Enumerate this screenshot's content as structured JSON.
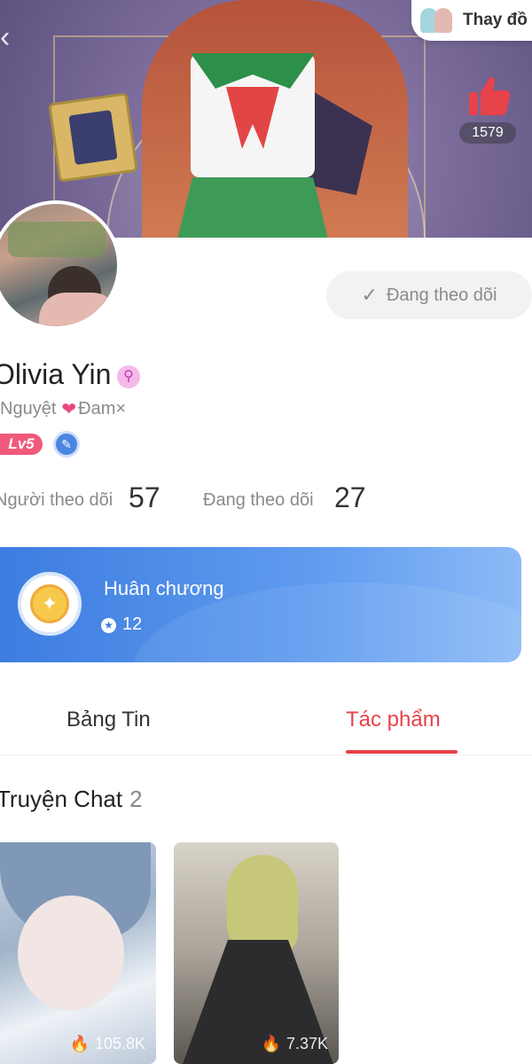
{
  "header": {
    "change_label": "Thay đồ",
    "like_count": "1579"
  },
  "profile": {
    "name": "Olivia Yin",
    "gender_symbol": "⚲",
    "tag_left": "Nguyệt",
    "tag_right": "Đam×",
    "level": "Lv5",
    "follow_button_label": "Đang theo dõi"
  },
  "stats": {
    "followers_label": "Người theo dõi",
    "followers_value": "57",
    "following_label": "Đang theo dõi",
    "following_value": "27"
  },
  "medal": {
    "title": "Huân chương",
    "count": "12"
  },
  "tabs": [
    {
      "label": "Bảng Tin",
      "active": false
    },
    {
      "label": "Tác phẩm",
      "active": true
    }
  ],
  "section": {
    "title": "Truyện Chat",
    "count": "2"
  },
  "stories": [
    {
      "views": "105.8K"
    },
    {
      "views": "7.37K"
    }
  ],
  "colors": {
    "accent": "#e8424b",
    "medal_card": "#3d7de0",
    "level_badge": "#f05a7a"
  }
}
